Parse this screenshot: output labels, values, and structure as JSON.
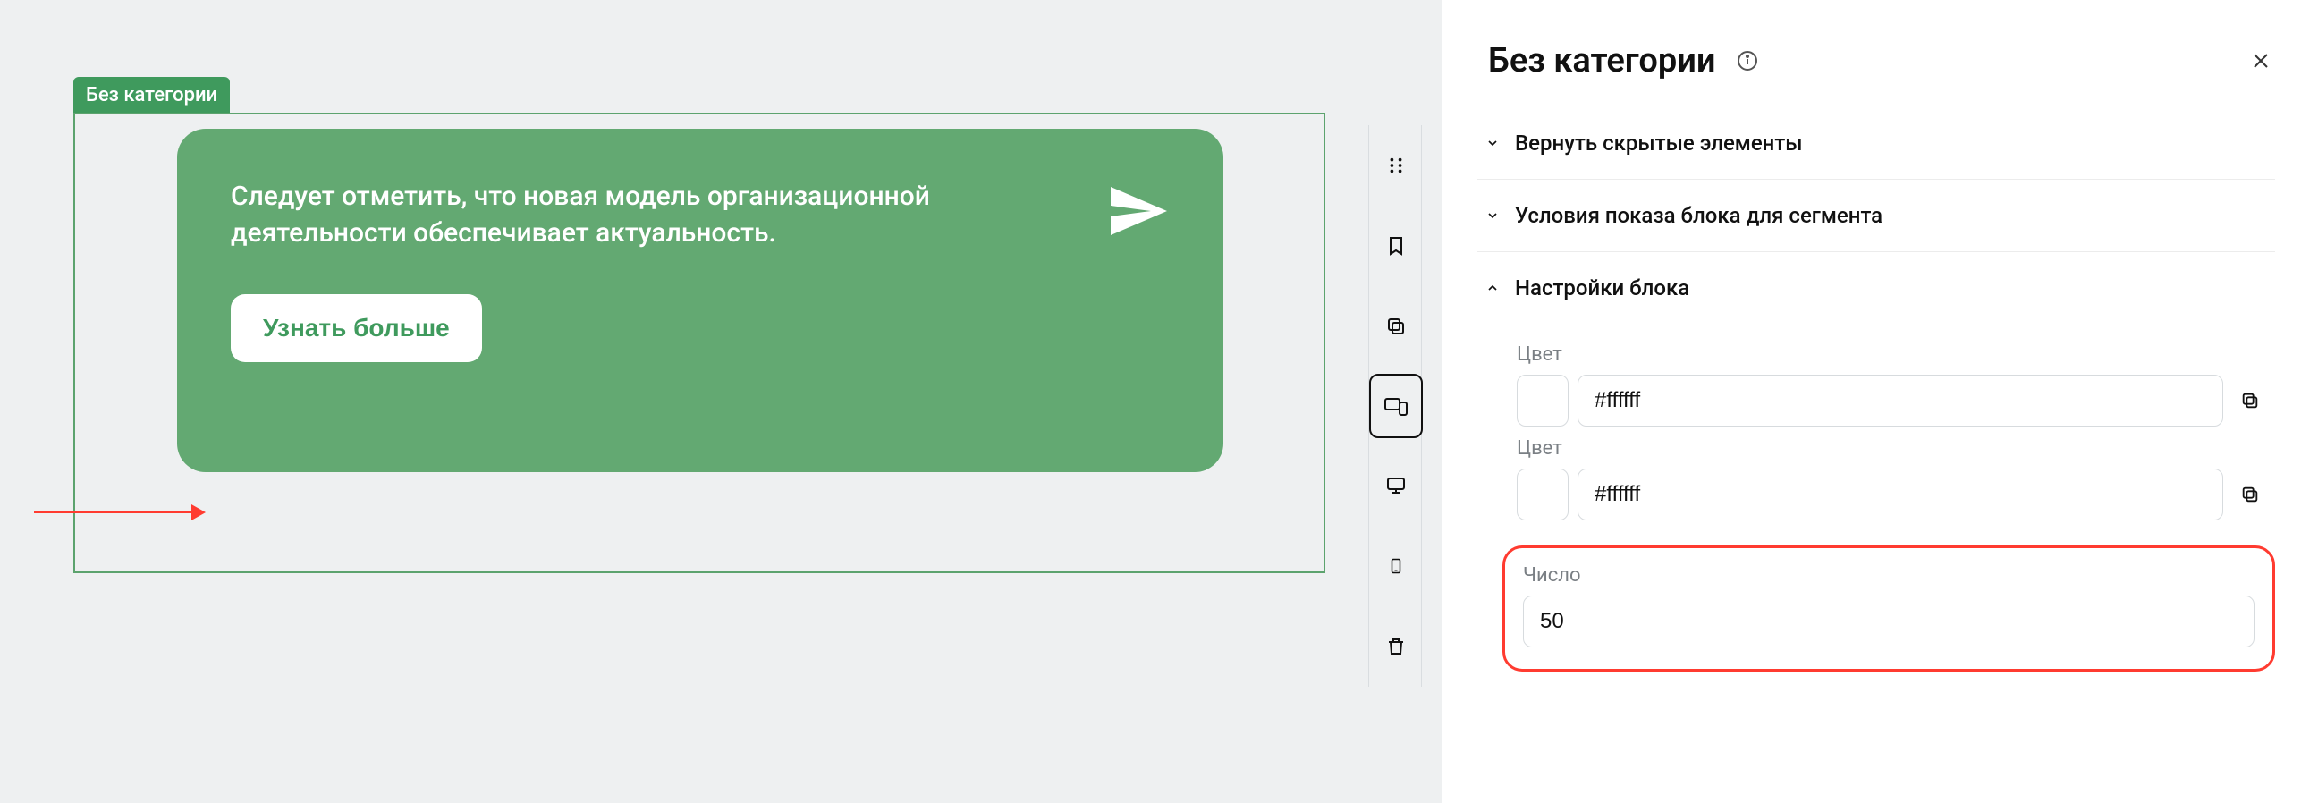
{
  "canvas": {
    "block_tag": "Без категории",
    "card_text": "Следует отметить, что новая модель организационной деятельности обеспечивает актуальность.",
    "card_button": "Узнать больше"
  },
  "toolbar": {
    "items": [
      {
        "name": "drag-handle-icon"
      },
      {
        "name": "bookmark-icon"
      },
      {
        "name": "copy-icon"
      },
      {
        "name": "devices-icon",
        "active": true
      },
      {
        "name": "desktop-icon"
      },
      {
        "name": "mobile-icon"
      },
      {
        "name": "trash-icon"
      }
    ]
  },
  "panel": {
    "title": "Без категории",
    "sections": {
      "restore": {
        "label": "Вернуть скрытые элементы"
      },
      "conditions": {
        "label": "Условия показа блока для сегмента"
      },
      "settings": {
        "label": "Настройки блока",
        "color1": {
          "label": "Цвет",
          "value": "#ffffff"
        },
        "color2": {
          "label": "Цвет",
          "value": "#ffffff"
        },
        "number": {
          "label": "Число",
          "value": "50"
        }
      }
    }
  }
}
